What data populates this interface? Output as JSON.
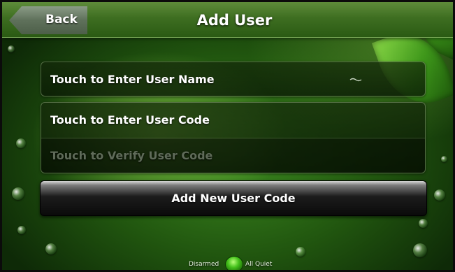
{
  "header": {
    "back_label": "Back",
    "title": "Add User"
  },
  "fields": {
    "user_name": "Touch to Enter User Name",
    "user_code": "Touch to Enter User Code",
    "verify_code": "Touch to Verify User Code"
  },
  "actions": {
    "add_button": "Add New User Code"
  },
  "status": {
    "arm_state": "Disarmed",
    "sensor_state": "All Quiet",
    "indicator_color": "#45c21c"
  },
  "colors": {
    "header_green": "#3e6e21",
    "background_green": "#21560f",
    "dim_text": "#5f6b59"
  },
  "icons": [
    "back-arrow-icon",
    "status-led-icon"
  ]
}
